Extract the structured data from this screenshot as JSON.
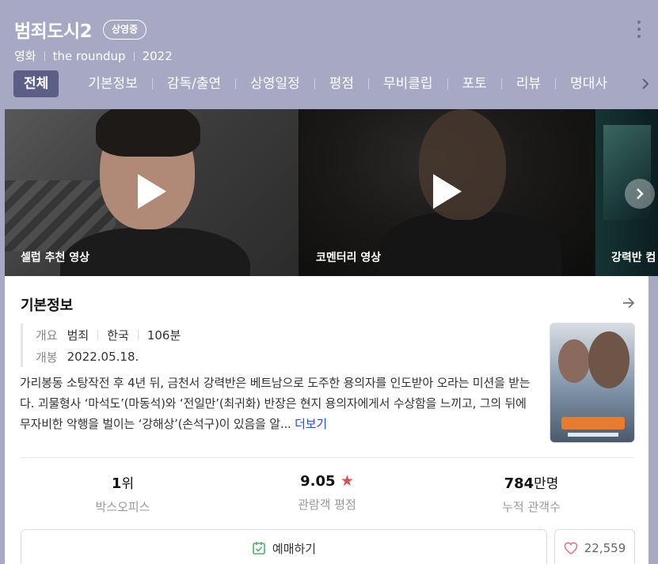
{
  "header": {
    "title": "범죄도시2",
    "badge": "상영중",
    "meta": [
      "영화",
      "the roundup",
      "2022"
    ]
  },
  "tabs": [
    {
      "label": "전체",
      "active": true
    },
    {
      "label": "기본정보"
    },
    {
      "label": "감독/출연"
    },
    {
      "label": "상영일정"
    },
    {
      "label": "평점"
    },
    {
      "label": "무비클립"
    },
    {
      "label": "포토"
    },
    {
      "label": "리뷰"
    },
    {
      "label": "명대사"
    }
  ],
  "videos": [
    {
      "caption": "셀럽 추천 영상"
    },
    {
      "caption": "코멘터리 영상"
    },
    {
      "caption": "강력반 컴"
    }
  ],
  "info": {
    "section_title": "기본정보",
    "summary_label": "개요",
    "summary_values": [
      "범죄",
      "한국",
      "106분"
    ],
    "release_label": "개봉",
    "release_value": "2022.05.18.",
    "synopsis": "가리봉동 소탕작전 후 4년 뒤, 금천서 강력반은 베트남으로 도주한 용의자를 인도받아 오라는 미션을 받는다. 괴물형사 ‘마석도’(마동석)와 ‘전일만’(최귀화) 반장은 현지 용의자에게서 수상함을 느끼고, 그의 뒤에 무자비한 악행을 벌이는 ‘강해상’(손석구)이 있음을 알...",
    "more_label": "더보기"
  },
  "stats": {
    "boxoffice_value": "1",
    "boxoffice_unit": "위",
    "boxoffice_label": "박스오피스",
    "rating_value": "9.05",
    "rating_star": "★",
    "rating_label": "관람객 평점",
    "audience_value": "784",
    "audience_unit": "만명",
    "audience_label": "누적 관객수"
  },
  "actions": {
    "book_label": "예매하기",
    "like_count": "22,559"
  },
  "colors": {
    "header_bg": "#a7a9c4",
    "active_tab": "#5b5e85",
    "star": "#e24c4c",
    "link": "#2b4fd6",
    "book_icon": "#4fb36b",
    "heart": "#e07a86"
  }
}
